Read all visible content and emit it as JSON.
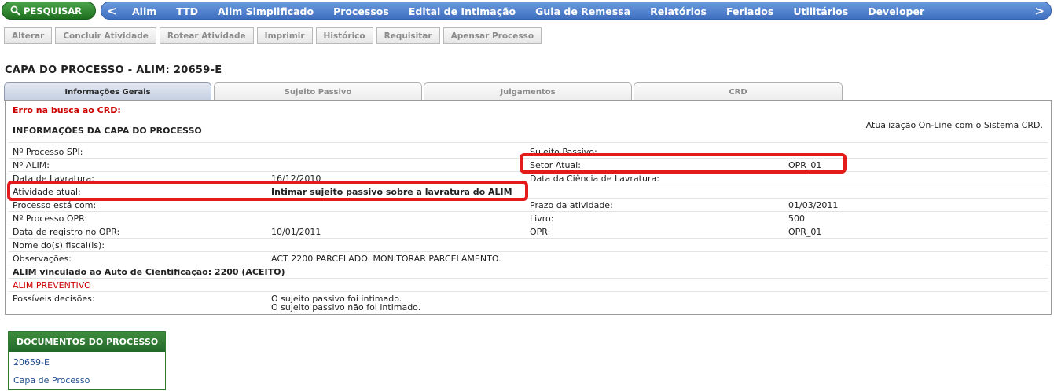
{
  "search": {
    "label": "PESQUISAR"
  },
  "nav": {
    "left_arrow": "<",
    "right_arrow": ">",
    "items": [
      "Alim",
      "TTD",
      "Alim Simplificado",
      "Processos",
      "Edital de Intimação",
      "Guia de Remessa",
      "Relatórios",
      "Feriados",
      "Utilitários",
      "Developer"
    ]
  },
  "toolbar": [
    "Alterar",
    "Concluir Atividade",
    "Rotear Atividade",
    "Imprimir",
    "Histórico",
    "Requisitar",
    "Apensar Processo"
  ],
  "page_title": "CAPA DO PROCESSO - ALIM: 20659-E",
  "tabs": [
    "Informações Gerais",
    "Sujeito Passivo",
    "Julgamentos",
    "CRD"
  ],
  "panel": {
    "error": "Erro na busca ao CRD:",
    "section_title": "INFORMAÇÕES DA CAPA DO PROCESSO",
    "online_note": "Atualização On-Line com o Sistema CRD.",
    "rows": {
      "r1": {
        "l1": "Nº Processo SPI:",
        "v1": "",
        "l2": "Sujeito Passivo:",
        "v2": ""
      },
      "r2": {
        "l1": "Nº ALIM:",
        "v1": "",
        "l2": "Setor Atual:",
        "v2": "OPR_01"
      },
      "r3": {
        "l1": "Data de Lavratura:",
        "v1": "16/12/2010",
        "l2": "Data da Ciência de Lavratura:",
        "v2": ""
      },
      "r4": {
        "l1": "Atividade atual:",
        "v1": "Intimar sujeito passivo sobre a lavratura do ALIM"
      },
      "r5": {
        "l1": "Processo está com:",
        "v1": "",
        "l2": "Prazo da atividade:",
        "v2": "01/03/2011"
      },
      "r6": {
        "l1": "Nº Processo OPR:",
        "v1": "",
        "l2": "Livro:",
        "v2": "500"
      },
      "r7": {
        "l1": "Data de registro no OPR:",
        "v1": "10/01/2011",
        "l2": "OPR:",
        "v2": "OPR_01"
      },
      "r8": {
        "l1": "Nome do(s) fiscal(is):",
        "v1": ""
      },
      "r9": {
        "l1": "Observações:",
        "v1": "ACT 2200 PARCELADO. MONITORAR PARCELAMENTO."
      },
      "r10": {
        "l1": "ALIM vinculado ao Auto de Cientificação: 2200 (ACEITO)"
      },
      "r11": {
        "l1": "ALIM PREVENTIVO"
      },
      "r12": {
        "l1": "Possíveis decisões:",
        "v1": "O sujeito passivo foi intimado.",
        "v1b": "O sujeito passivo não foi intimado."
      }
    }
  },
  "documents": {
    "title": "DOCUMENTOS DO PROCESSO",
    "links": [
      "20659-E",
      "Capa de Processo"
    ]
  },
  "colors": {
    "nav_blue": "#4f7fce",
    "green": "#2e7d32",
    "highlight_red": "#e31b1b",
    "error_red": "#cc0000"
  }
}
